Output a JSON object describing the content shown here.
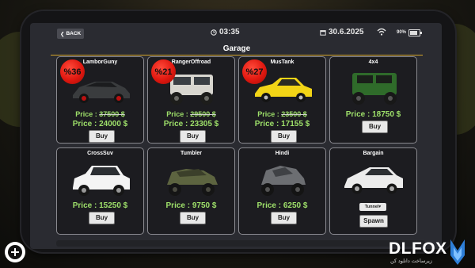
{
  "status": {
    "back_label": "BACK",
    "time": "03:35",
    "date": "30.6.2025",
    "battery": "90%"
  },
  "garage": {
    "title": "Garage",
    "cars": [
      {
        "name": "LamborGuny",
        "discount": "%36",
        "old_price": "37500 $",
        "price": "24000 $",
        "button": "Buy",
        "color": "#3a3c3e"
      },
      {
        "name": "RangerOffroad",
        "discount": "%21",
        "old_price": "29500 $",
        "price": "23305 $",
        "button": "Buy",
        "color": "#d8d6cf"
      },
      {
        "name": "MusTank",
        "discount": "%27",
        "old_price": "23500 $",
        "price": "17155 $",
        "button": "Buy",
        "color": "#f2d416"
      },
      {
        "name": "4x4",
        "price": "18750 $",
        "button": "Buy",
        "color": "#2f6b2a"
      },
      {
        "name": "CrossSuv",
        "price": "15250 $",
        "button": "Buy",
        "color": "#f4f4f4"
      },
      {
        "name": "Tumbler",
        "price": "9750 $",
        "button": "Buy",
        "color": "#5d6440"
      },
      {
        "name": "Hindi",
        "price": "6250 $",
        "button": "Buy",
        "color": "#6c6e72"
      },
      {
        "name": "Bargain",
        "tunnel": "Tunnel",
        "button": "Spawn",
        "color": "#ececec"
      }
    ],
    "price_label": "Price :"
  },
  "watermark": {
    "brand": "DLFOX",
    "tagline": "زیرساخت دانلود کن"
  }
}
